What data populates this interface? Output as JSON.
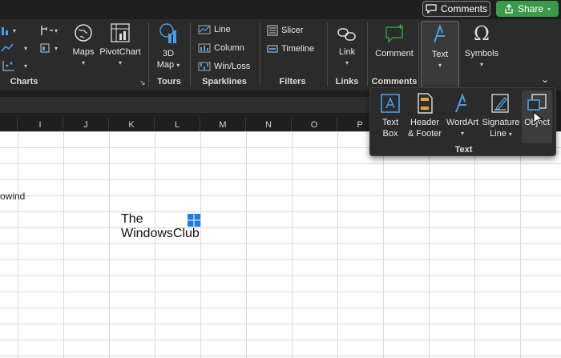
{
  "topbar": {
    "comments_label": "Comments",
    "share_label": "Share"
  },
  "ribbon": {
    "groups": {
      "charts": "Charts",
      "tours": "Tours",
      "sparklines": "Sparklines",
      "filters": "Filters",
      "links": "Links",
      "comments": "Comments"
    },
    "buttons": {
      "maps": "Maps",
      "pivotchart": "PivotChart",
      "map3d_line1": "3D",
      "map3d_line2": "Map",
      "line": "Line",
      "column": "Column",
      "winloss": "Win/Loss",
      "slicer": "Slicer",
      "timeline": "Timeline",
      "link": "Link",
      "comment": "Comment",
      "text": "Text",
      "symbols": "Symbols"
    }
  },
  "columns": [
    "I",
    "J",
    "K",
    "L",
    "M",
    "N",
    "O",
    "P"
  ],
  "cell_text": "owind",
  "logo": {
    "line1": "The",
    "line2": "WindowsClub"
  },
  "text_dropdown": {
    "label": "Text",
    "items": {
      "textbox_1": "Text",
      "textbox_2": "Box",
      "header_1": "Header",
      "header_2": "& Footer",
      "wordart": "WordArt",
      "sig_1": "Signature",
      "sig_2": "Line",
      "object": "Object"
    }
  },
  "colors": {
    "accent": "#4a9fe8",
    "share_green": "#3a9a4a",
    "ribbon_bg": "#2b2b2b"
  }
}
